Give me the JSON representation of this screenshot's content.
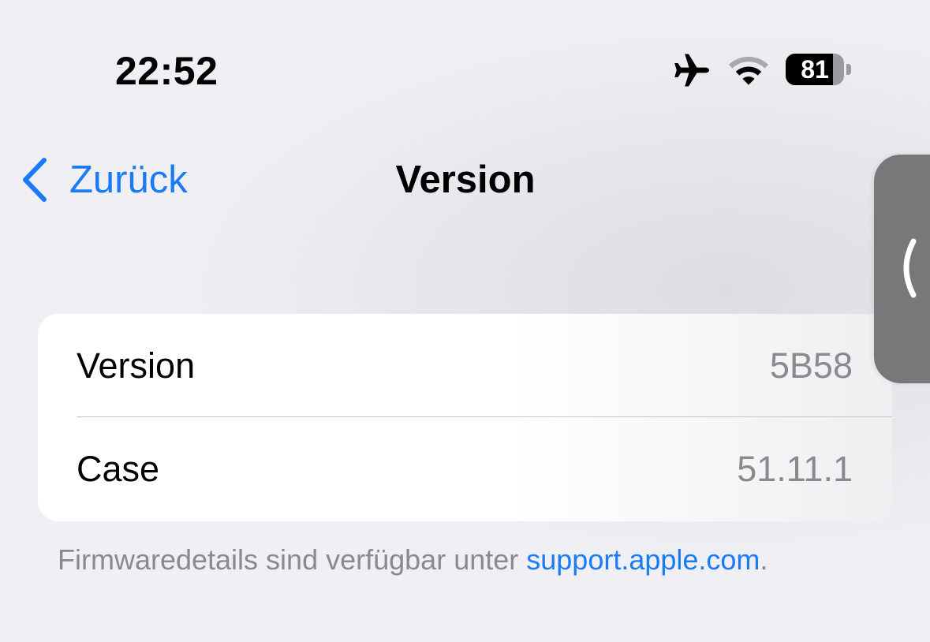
{
  "status_bar": {
    "time": "22:52",
    "battery_percent": "81",
    "battery_level": 0.81,
    "icons": [
      "airplane-icon",
      "wifi-icon",
      "battery-icon"
    ]
  },
  "nav": {
    "back_label": "Zurück",
    "title": "Version"
  },
  "list": {
    "rows": [
      {
        "label": "Version",
        "value": "5B58"
      },
      {
        "label": "Case",
        "value": "51.11.1"
      }
    ]
  },
  "footer": {
    "text": "Firmwaredetails sind verfügbar unter ",
    "link": "support.apple.com",
    "suffix": "."
  },
  "side_tab": {
    "icon": "chevron-left-icon"
  },
  "colors": {
    "accent": "#1a7cf4",
    "background": "#efeff4",
    "secondary_text": "#8a8a8e"
  }
}
